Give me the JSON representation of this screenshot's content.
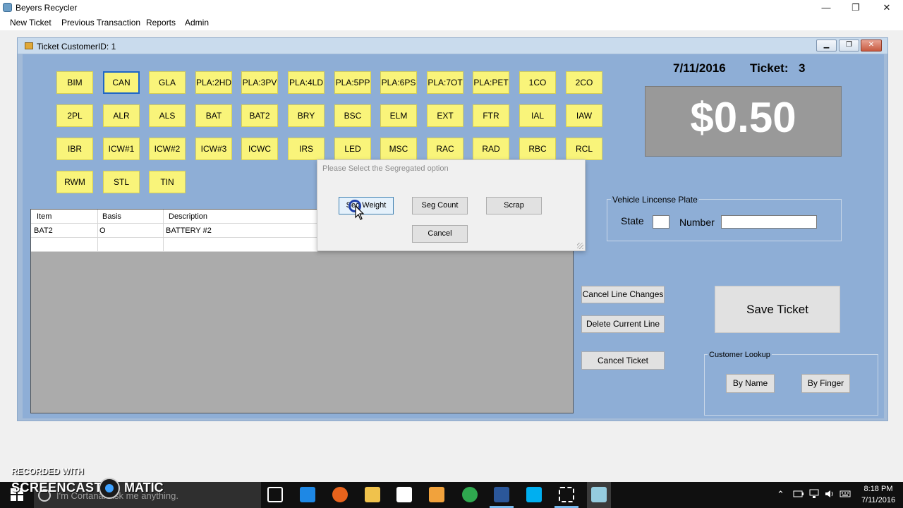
{
  "app": {
    "title": "Beyers Recycler",
    "window_controls": {
      "minimize": "—",
      "restore": "❐",
      "close": "✕"
    }
  },
  "menu": [
    "New Ticket",
    "Previous Transaction",
    "Reports",
    "Admin"
  ],
  "ticket_window": {
    "title": "Ticket  CustomerID: 1",
    "controls": {
      "minimize": "▁",
      "restore": "❐",
      "close": "✕"
    }
  },
  "materials": [
    [
      "BIM",
      "CAN",
      "GLA",
      "PLA:2HD",
      "PLA:3PV",
      "PLA:4LD",
      "PLA:5PP",
      "PLA:6PS",
      "PLA:7OT",
      "PLA:PET",
      "1CO",
      "2CO"
    ],
    [
      "2PL",
      "ALR",
      "ALS",
      "BAT",
      "BAT2",
      "BRY",
      "BSC",
      "ELM",
      "EXT",
      "FTR",
      "IAL",
      "IAW"
    ],
    [
      "IBR",
      "ICW#1",
      "ICW#2",
      "ICW#3",
      "ICWC",
      "IRS",
      "LED",
      "MSC",
      "RAC",
      "RAD",
      "RBC",
      "RCL"
    ],
    [
      "RWM",
      "STL",
      "TIN"
    ]
  ],
  "selected_material": "CAN",
  "grid": {
    "columns": [
      "Item",
      "Basis",
      "Description"
    ],
    "rows": [
      [
        "BAT2",
        "O",
        "BATTERY #2"
      ]
    ]
  },
  "header": {
    "date": "7/11/2016",
    "ticket_label": "Ticket:",
    "ticket_number": "3"
  },
  "total": "$0.50",
  "plate": {
    "legend": "Vehicle Lincense Plate",
    "state_label": "State",
    "number_label": "Number",
    "state_value": "",
    "number_value": ""
  },
  "actions": {
    "cancel_line_changes": "Cancel Line Changes",
    "delete_current_line": "Delete Current Line",
    "cancel_ticket": "Cancel Ticket",
    "save_ticket": "Save Ticket"
  },
  "lookup": {
    "legend": "Customer Lookup",
    "by_name": "By Name",
    "by_finger": "By Finger"
  },
  "dialog": {
    "title": "Please Select the Segregated option",
    "seg_weight": "Seg Weight",
    "seg_count": "Seg Count",
    "scrap": "Scrap",
    "cancel": "Cancel"
  },
  "watermark": {
    "recorded": "RECORDED WITH",
    "brand_left": "SCREENCAST",
    "brand_right": "MATIC"
  },
  "taskbar": {
    "cortana_placeholder": "I'm Cortana. Ask me anything.",
    "time": "8:18 PM",
    "date": "7/11/2016",
    "icons": [
      "task-view-icon",
      "edge-icon",
      "firefox-icon",
      "file-explorer-icon",
      "store-icon",
      "media-icon",
      "chrome-icon",
      "word-icon",
      "skype-icon",
      "snipping-tool-icon",
      "recycler-app-icon"
    ]
  }
}
